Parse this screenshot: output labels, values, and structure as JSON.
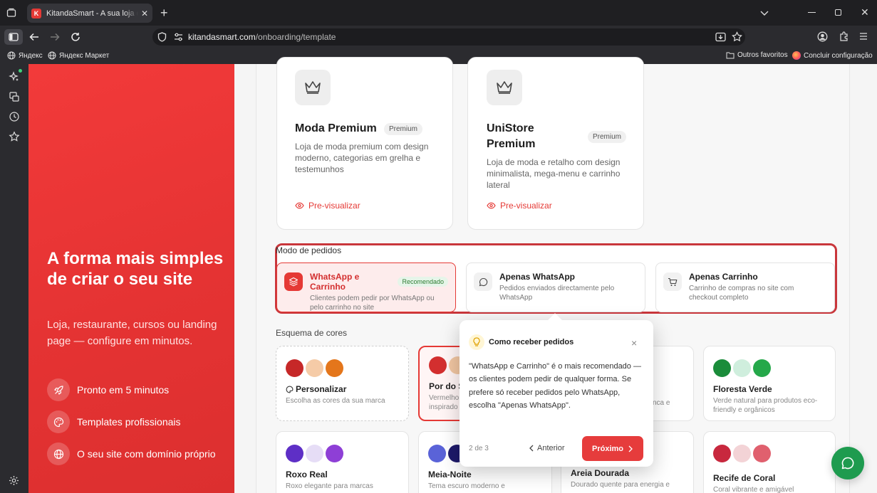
{
  "browser": {
    "tab_title": "KitandaSmart - A sua loja online",
    "tab_favicon": "K",
    "new_tab": "+",
    "url_domain": "kitandasmart.com",
    "url_path": "/onboarding/template",
    "bookmarks": [
      "Яндекс",
      "Яндекс Маркет"
    ],
    "bookmark_other": "Outros favoritos",
    "bookmark_setup": "Concluir configuração"
  },
  "hero": {
    "title": "A forma mais simples de criar o seu site",
    "subtitle": "Loja, restaurante, cursos ou landing page — configure em minutos.",
    "features": [
      "Pronto em 5 minutos",
      "Templates profissionais",
      "O seu site com domínio próprio"
    ]
  },
  "templates": [
    {
      "name": "Moda Premium",
      "badge": "Premium",
      "description": "Loja de moda premium com design moderno, categorias em grelha e testemunhos",
      "preview": "Pre-visualizar"
    },
    {
      "name": "UniStore Premium",
      "badge": "Premium",
      "description": "Loja de moda e retalho com design minimalista, mega-menu e carrinho lateral",
      "preview": "Pre-visualizar"
    }
  ],
  "order_mode": {
    "label": "Modo de pedidos",
    "options": [
      {
        "title": "WhatsApp e Carrinho",
        "badge": "Recomendado",
        "description": "Clientes podem pedir por WhatsApp ou pelo carrinho no site",
        "selected": true
      },
      {
        "title": "Apenas WhatsApp",
        "description": "Pedidos enviados directamente pelo WhatsApp"
      },
      {
        "title": "Apenas Carrinho",
        "description": "Carrinho de compras no site com checkout completo"
      }
    ]
  },
  "color_scheme": {
    "label": "Esquema de cores",
    "schemes": [
      {
        "name": "Personalizar",
        "description": "Escolha as cores da sua marca",
        "colors": [
          "#c62828",
          "#f5cba7",
          "#e4761b"
        ]
      },
      {
        "name": "Por do S",
        "description": "Vermelho inspirado",
        "colors": [
          "#d32f2f",
          "#f1c6a2"
        ]
      },
      {
        "name": "",
        "description": "nca e",
        "colors": []
      },
      {
        "name": "Floresta Verde",
        "description": "Verde natural para produtos eco-friendly e orgânicos",
        "colors": [
          "#1a8c3a",
          "#cfeedd",
          "#25a84a"
        ]
      },
      {
        "name": "Roxo Real",
        "description": "Roxo elegante para marcas",
        "colors": [
          "#5e2fc6",
          "#e6ddf6",
          "#8e3fd6"
        ]
      },
      {
        "name": "Meia-Noite",
        "description": "Tema escuro moderno e",
        "colors": [
          "#5a63d8",
          "#1e1a6a"
        ]
      },
      {
        "name": "Areia Dourada",
        "description": "Dourado quente para energia e",
        "colors": []
      },
      {
        "name": "Recife de Coral",
        "description": "Coral vibrante e amigável",
        "colors": [
          "#c8283e",
          "#f3d3d6",
          "#e0606e"
        ]
      }
    ]
  },
  "tour": {
    "title": "Como receber pedidos",
    "body": "\"WhatsApp e Carrinho\" é o mais recomendado — os clientes podem pedir de qualquer forma. Se prefere só receber pedidos pelo WhatsApp, escolha \"Apenas WhatsApp\".",
    "step": "2 de 3",
    "back": "Anterior",
    "next": "Próximo",
    "close": "×"
  }
}
